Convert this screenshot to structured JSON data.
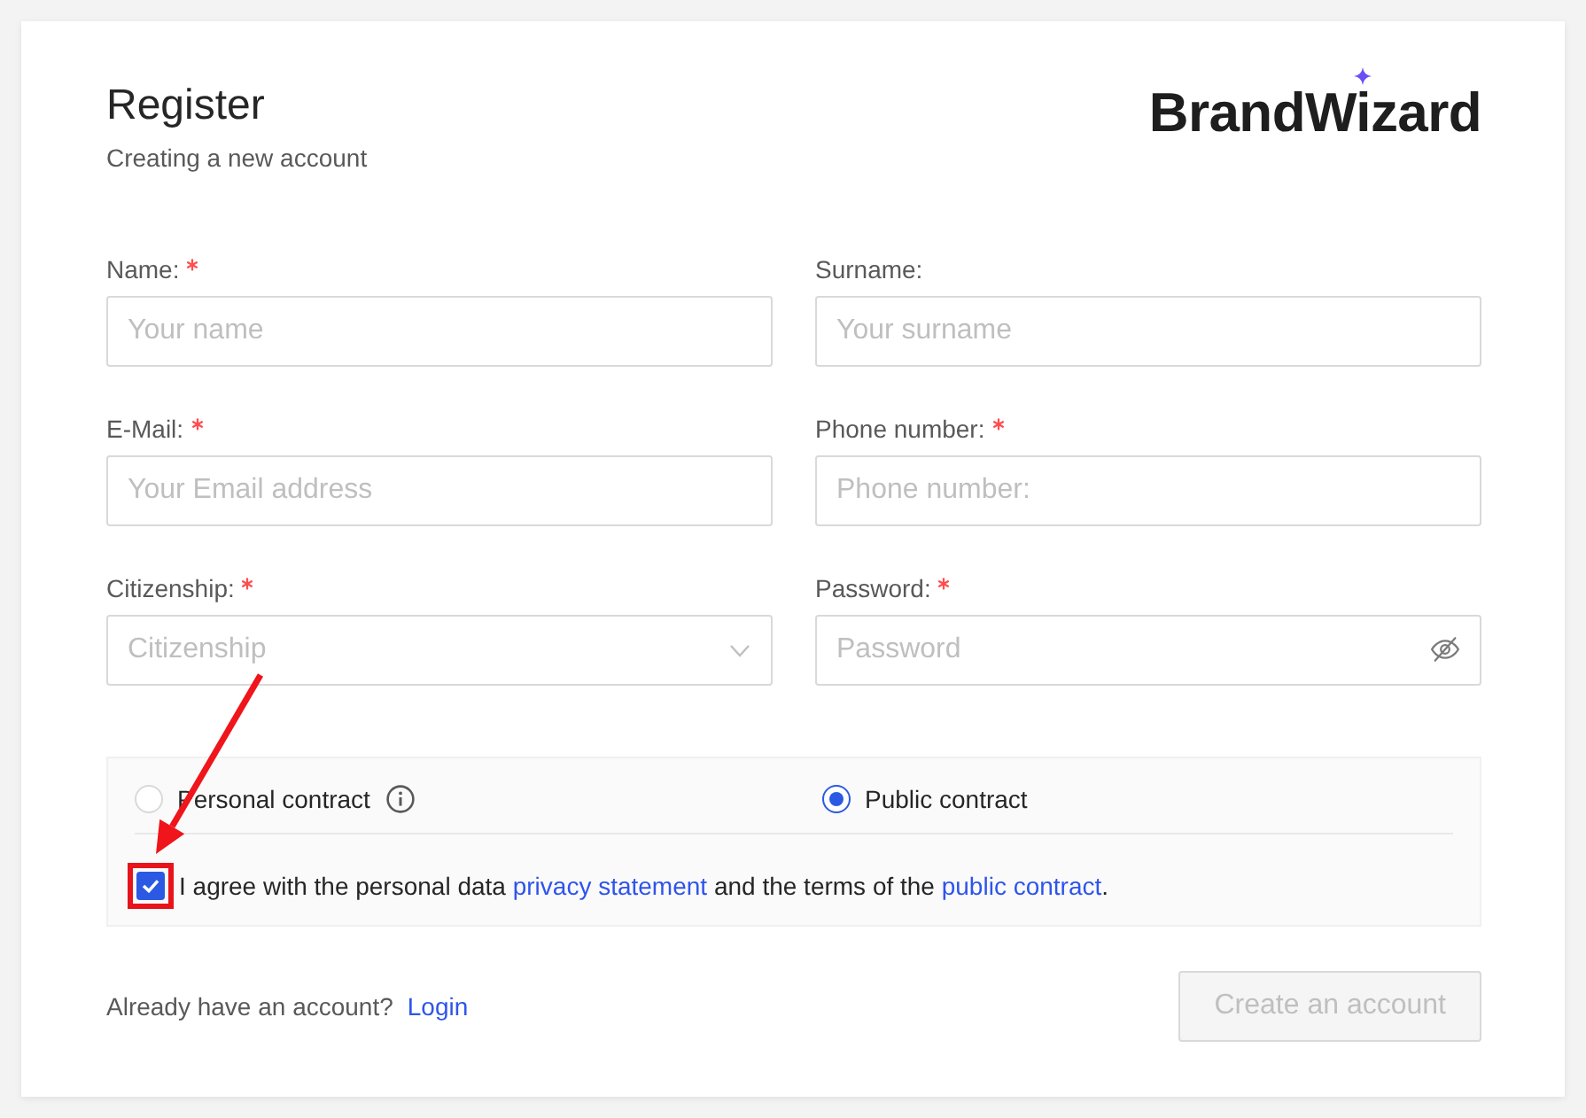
{
  "header": {
    "title": "Register",
    "subtitle": "Creating a new account",
    "logo": "BrandWizard"
  },
  "fields": [
    {
      "label": "Name:",
      "required": true,
      "kind": "text",
      "placeholder": "Your name"
    },
    {
      "label": "Surname:",
      "required": false,
      "kind": "text",
      "placeholder": "Your surname"
    },
    {
      "label": "E-Mail:",
      "required": true,
      "kind": "text",
      "placeholder": "Your Email address"
    },
    {
      "label": "Phone number:",
      "required": true,
      "kind": "text",
      "placeholder": "Phone number:"
    },
    {
      "label": "Citizenship:",
      "required": true,
      "kind": "select",
      "placeholder": "Citizenship"
    },
    {
      "label": "Password:",
      "required": true,
      "kind": "password",
      "placeholder": "Password"
    }
  ],
  "contract_types": [
    {
      "label": "Personal contract",
      "selected": false,
      "info": true
    },
    {
      "label": "Public contract",
      "selected": true,
      "info": false
    }
  ],
  "agreement": {
    "checked": true,
    "parts": [
      {
        "kind": "text",
        "text": "I agree with the personal data "
      },
      {
        "kind": "link",
        "text": "privacy statement"
      },
      {
        "kind": "text",
        "text": " and the terms of the "
      },
      {
        "kind": "link",
        "text": "public contract"
      },
      {
        "kind": "text",
        "text": "."
      }
    ]
  },
  "footer": {
    "prompt": "Already have an account?",
    "link": "Login",
    "button": {
      "label": "Create an account",
      "disabled": true
    }
  }
}
